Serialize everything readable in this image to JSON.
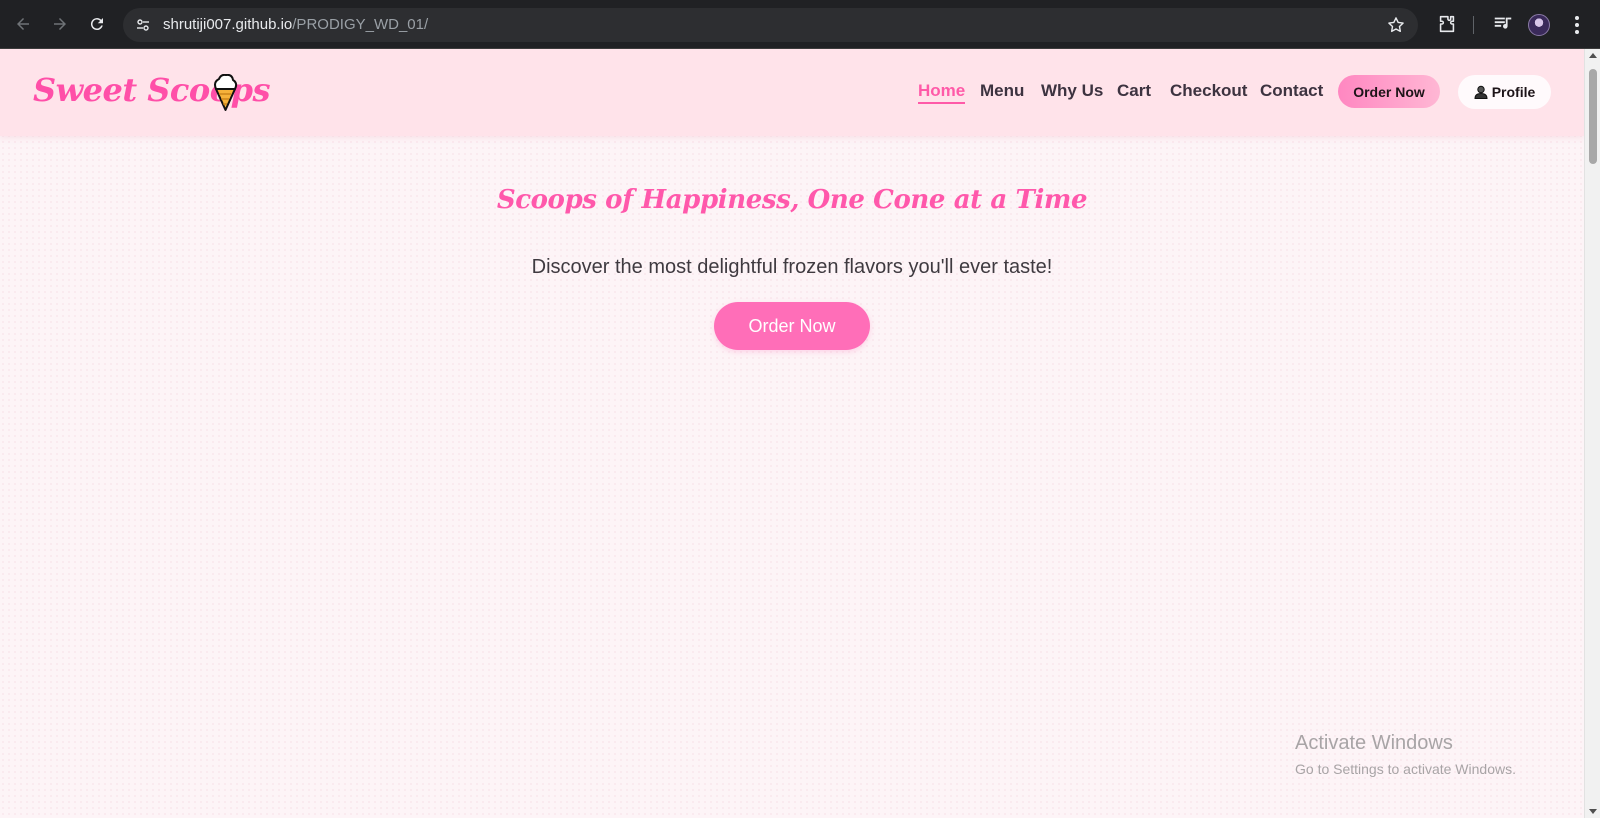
{
  "browser": {
    "url_host": "shrutiji007.github.io",
    "url_path": "/PRODIGY_WD_01/"
  },
  "header": {
    "logo_text": "Sweet Scoops",
    "logo_icon": "ice-cream-cone",
    "nav": [
      {
        "label": "Home",
        "active": true
      },
      {
        "label": "Menu",
        "active": false
      },
      {
        "label": "Why Us",
        "active": false
      },
      {
        "label": "Cart",
        "active": false
      },
      {
        "label": "Checkout",
        "active": false
      },
      {
        "label": "Contact",
        "active": false
      }
    ],
    "order_button": "Order Now",
    "profile_button": "Profile",
    "profile_icon": "person-icon"
  },
  "hero": {
    "title": "Scoops of Happiness, One Cone at a Time",
    "subtitle": "Discover the most delightful frozen flavors you'll ever taste!",
    "cta": "Order Now"
  },
  "watermark": {
    "title": "Activate Windows",
    "subtitle": "Go to Settings to activate Windows."
  },
  "colors": {
    "brand_pink": "#ff4fa8",
    "header_bg": "#ffe3ea",
    "cta_pink": "#ff6eb8",
    "page_bg": "#fdf4f7"
  }
}
